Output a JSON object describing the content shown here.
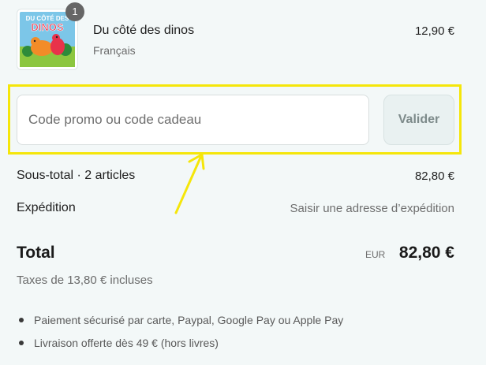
{
  "cart_item": {
    "quantity": "1",
    "name": "Du côté des dinos",
    "variant": "Français",
    "price": "12,90 €",
    "cover_title_line1": "DU CÔTÉ DES",
    "cover_title_line2": "DINOS"
  },
  "promo": {
    "placeholder": "Code promo ou code cadeau",
    "value": "",
    "submit_label": "Valider"
  },
  "summary": {
    "subtotal_label": "Sous-total · 2 articles",
    "subtotal_value": "82,80 €",
    "shipping_label": "Expédition",
    "shipping_value": "Saisir une adresse d’expédition",
    "total_label": "Total",
    "total_currency": "EUR",
    "total_value": "82,80 €",
    "taxes_note": "Taxes de 13,80 € incluses"
  },
  "benefits": [
    "Paiement sécurisé par carte, Paypal, Google Pay ou Apple Pay",
    "Livraison offerte dès 49 € (hors livres)"
  ],
  "colors": {
    "highlight": "#f5e60a",
    "background": "#f3f8f8",
    "button_bg": "#e9f1f1"
  }
}
